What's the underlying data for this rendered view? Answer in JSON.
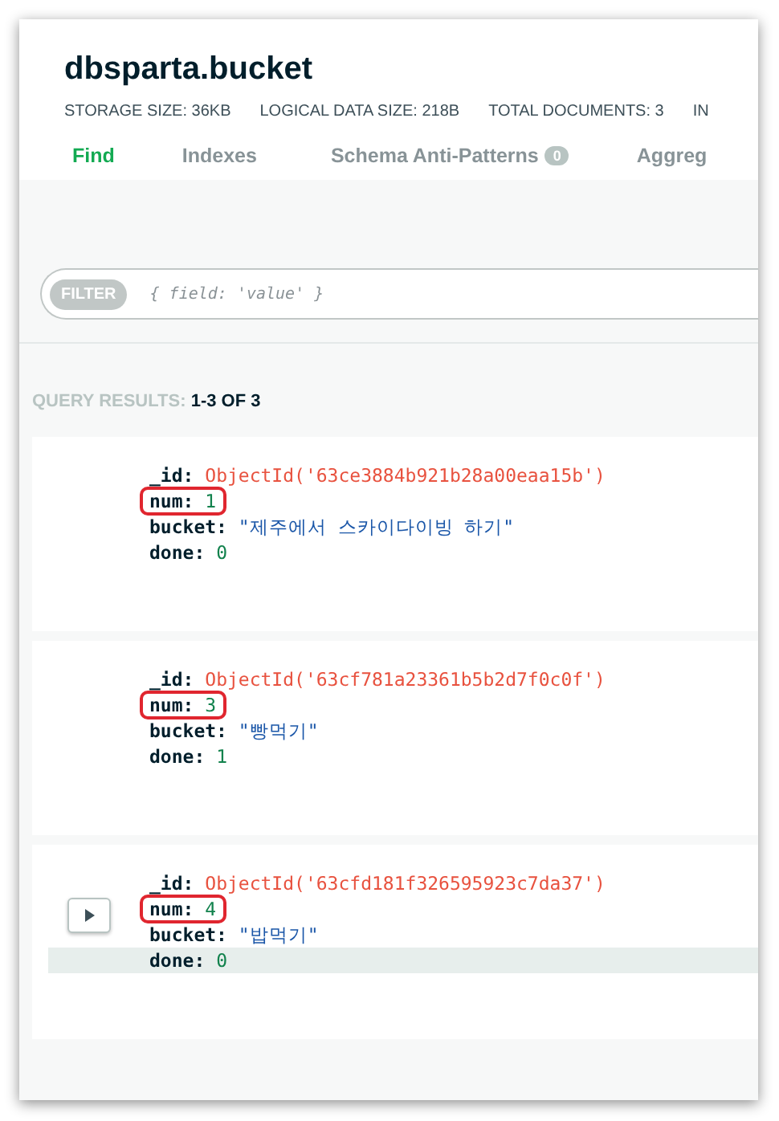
{
  "collection": {
    "title": "dbsparta.bucket",
    "stats": [
      "STORAGE SIZE: 36KB",
      "LOGICAL DATA SIZE: 218B",
      "TOTAL DOCUMENTS: 3",
      "IN"
    ]
  },
  "tabs": [
    {
      "label": "Find",
      "selected": true
    },
    {
      "label": "Indexes",
      "selected": false
    },
    {
      "label": "Schema Anti-Patterns",
      "badge": "0",
      "selected": false
    },
    {
      "label": "Aggreg",
      "selected": false
    }
  ],
  "filter": {
    "label": "FILTER",
    "placeholder": "{ field: 'value' }"
  },
  "query_results": {
    "label": "QUERY RESULTS:",
    "range": "1-3 OF 3"
  },
  "documents": [
    {
      "expand_button": false,
      "fields": [
        {
          "key": "_id:",
          "value": "ObjectId('63ce3884b921b28a00eaa15b')",
          "kind": "objectid",
          "circled": false,
          "hovered": false
        },
        {
          "key": "num:",
          "value": "1",
          "kind": "number",
          "circled": true,
          "hovered": false
        },
        {
          "key": "bucket:",
          "value": "\"제주에서 스카이다이빙 하기\"",
          "kind": "string",
          "circled": false,
          "hovered": false
        },
        {
          "key": "done:",
          "value": "0",
          "kind": "number",
          "circled": false,
          "hovered": false
        }
      ]
    },
    {
      "expand_button": false,
      "fields": [
        {
          "key": "_id:",
          "value": "ObjectId('63cf781a23361b5b2d7f0c0f')",
          "kind": "objectid",
          "circled": false,
          "hovered": false
        },
        {
          "key": "num:",
          "value": "3",
          "kind": "number",
          "circled": true,
          "hovered": false
        },
        {
          "key": "bucket:",
          "value": "\"빵먹기\"",
          "kind": "string",
          "circled": false,
          "hovered": false
        },
        {
          "key": "done:",
          "value": "1",
          "kind": "number",
          "circled": false,
          "hovered": false
        }
      ]
    },
    {
      "expand_button": true,
      "fields": [
        {
          "key": "_id:",
          "value": "ObjectId('63cfd181f326595923c7da37')",
          "kind": "objectid",
          "circled": false,
          "hovered": false
        },
        {
          "key": "num:",
          "value": "4",
          "kind": "number",
          "circled": true,
          "hovered": false
        },
        {
          "key": "bucket:",
          "value": "\"밥먹기\"",
          "kind": "string",
          "circled": false,
          "hovered": false
        },
        {
          "key": "done:",
          "value": "0",
          "kind": "number",
          "circled": false,
          "hovered": true
        }
      ]
    }
  ]
}
